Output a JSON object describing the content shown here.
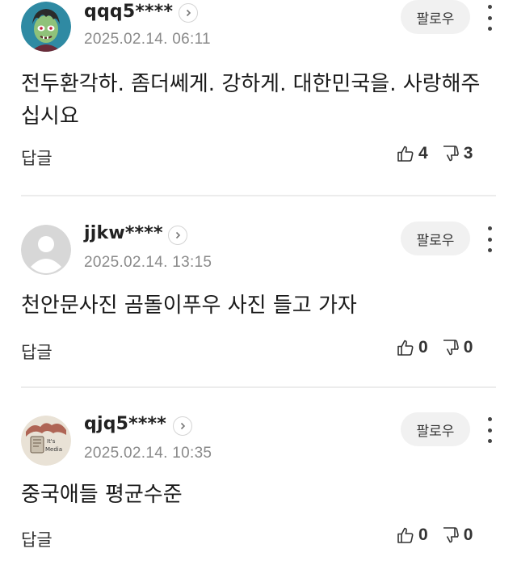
{
  "follow_label": "팔로우",
  "reply_label": "답글",
  "comments": [
    {
      "username": "qqq5****",
      "date": "2025.02.14. 06:11",
      "text": "전두환각하. 좀더쎄게. 강하게. 대한민국을. 사랑해주십시요",
      "likes": "4",
      "dislikes": "3",
      "avatar": "zombie-cartoon-avatar"
    },
    {
      "username": "jjkw****",
      "date": "2025.02.14. 13:15",
      "text": "천안문사진 곰돌이푸우 사진 들고 가자",
      "likes": "0",
      "dislikes": "0",
      "avatar": "default-user-avatar"
    },
    {
      "username": "qjq5****",
      "date": "2025.02.14. 10:35",
      "text": "중국애들 평균수준",
      "likes": "0",
      "dislikes": "0",
      "avatar": "media-photo-avatar",
      "avatar_text": [
        "It's",
        "Media"
      ]
    }
  ]
}
